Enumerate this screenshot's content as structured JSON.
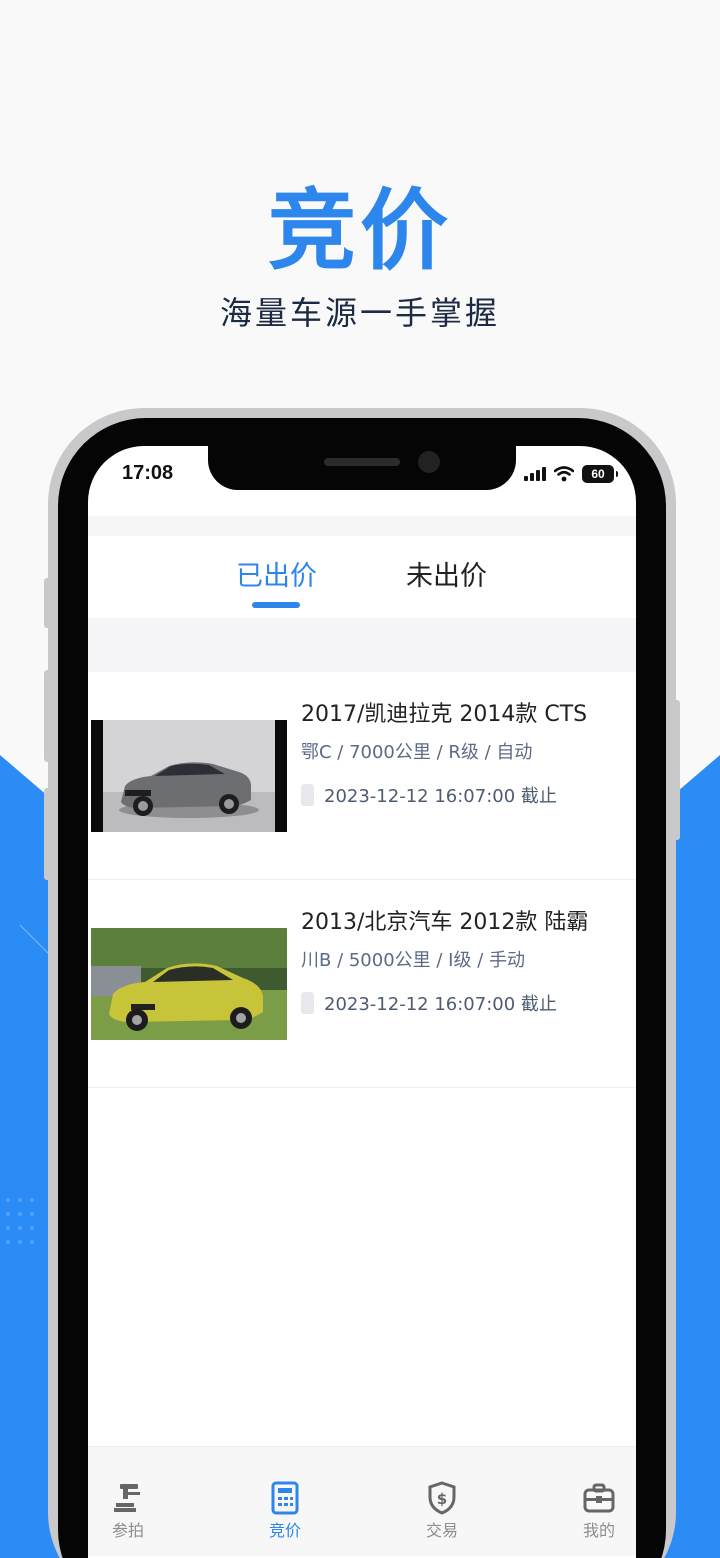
{
  "promo": {
    "title": "竞价",
    "subtitle": "海量车源一手掌握"
  },
  "colors": {
    "accent": "#2c86ec",
    "background_blue": "#2b8cf5",
    "title_dark": "#1c2a44"
  },
  "status_bar": {
    "time": "17:08",
    "battery": "60",
    "icons": [
      "signal-icon",
      "wifi-icon",
      "battery-icon"
    ]
  },
  "tabs": [
    {
      "label": "已出价",
      "active": true
    },
    {
      "label": "未出价",
      "active": false
    }
  ],
  "listings": [
    {
      "title": "2017/凯迪拉克 2014款 CTS",
      "meta": "鄂C / 7000公里 / R级 / 自动",
      "deadline": "2023-12-12 16:07:00 截止",
      "image": "car-photo-silver-sedan"
    },
    {
      "title": "2013/北京汽车 2012款 陆霸",
      "meta": "川B / 5000公里 / I级 / 手动",
      "deadline": "2023-12-12 16:07:00 截止",
      "image": "car-photo-yellow-sedan"
    }
  ],
  "bottom_nav": [
    {
      "label": "参拍",
      "icon": "gavel-icon",
      "active": false
    },
    {
      "label": "竞价",
      "icon": "calculator-icon",
      "active": true
    },
    {
      "label": "交易",
      "icon": "shield-dollar-icon",
      "active": false
    },
    {
      "label": "我的",
      "icon": "briefcase-icon",
      "active": false
    }
  ]
}
